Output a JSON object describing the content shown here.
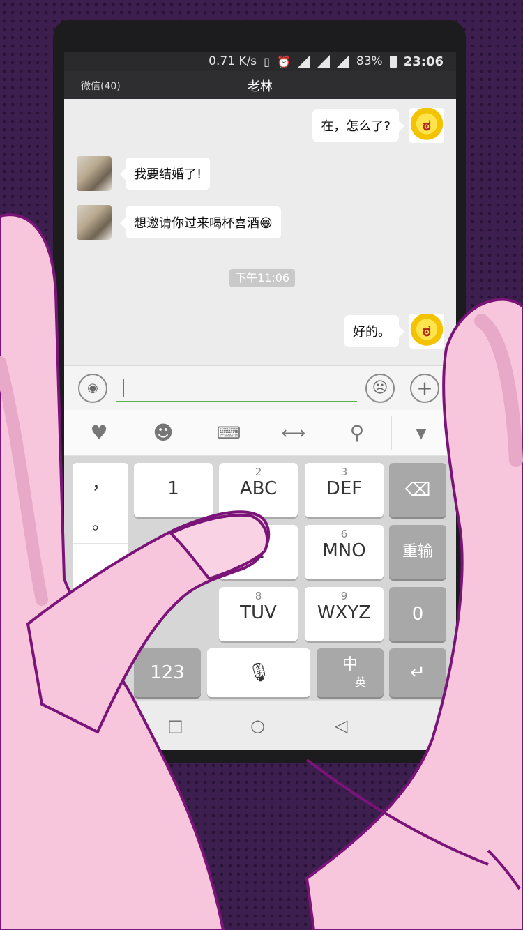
{
  "statusbar": {
    "speed": "0.71 K/s",
    "vibrate_icon": "vibrate-icon",
    "alarm_icon": "alarm-icon",
    "battery": "83%",
    "time": "23:06"
  },
  "titlebar": {
    "back_label": "微信(40)",
    "contact_name": "老林"
  },
  "messages": [
    {
      "side": "right",
      "text": "在，怎么了?"
    },
    {
      "side": "left",
      "text": "我要结婚了!"
    },
    {
      "side": "left",
      "text": "想邀请你过来喝杯喜酒😁"
    },
    {
      "side": "right",
      "text": "好的。"
    }
  ],
  "timestamp": "下午11:06",
  "input": {
    "voice_icon": "voice-icon",
    "emoji_icon": "emoji-face-icon",
    "plus_icon": "plus-icon",
    "value": ""
  },
  "toolbar": {
    "icons": [
      "heart-icon",
      "emoji-wink-icon",
      "keyboard-icon",
      "cursor-move-icon",
      "search-icon",
      "collapse-icon"
    ]
  },
  "keyboard": {
    "symbols": [
      "，",
      "。"
    ],
    "keys": [
      {
        "sub": "",
        "main": "1"
      },
      {
        "sub": "2",
        "main": "ABC"
      },
      {
        "sub": "3",
        "main": "DEF"
      },
      {
        "sub": "6",
        "main": "MNO"
      },
      {
        "sub": "8",
        "main": "TUV"
      },
      {
        "sub": "9",
        "main": "WXYZ"
      }
    ],
    "partial_key": "L",
    "delete_icon": "backspace-icon",
    "reinput_label": "重输",
    "zero_label": "0",
    "num_mode_label": "123",
    "mic_icon": "microphone-icon",
    "lang_main": "中",
    "lang_sub": "英",
    "enter_icon": "enter-icon"
  },
  "navbar": {
    "recent_icon": "square-icon",
    "home_icon": "circle-icon",
    "back_icon": "triangle-back-icon"
  }
}
